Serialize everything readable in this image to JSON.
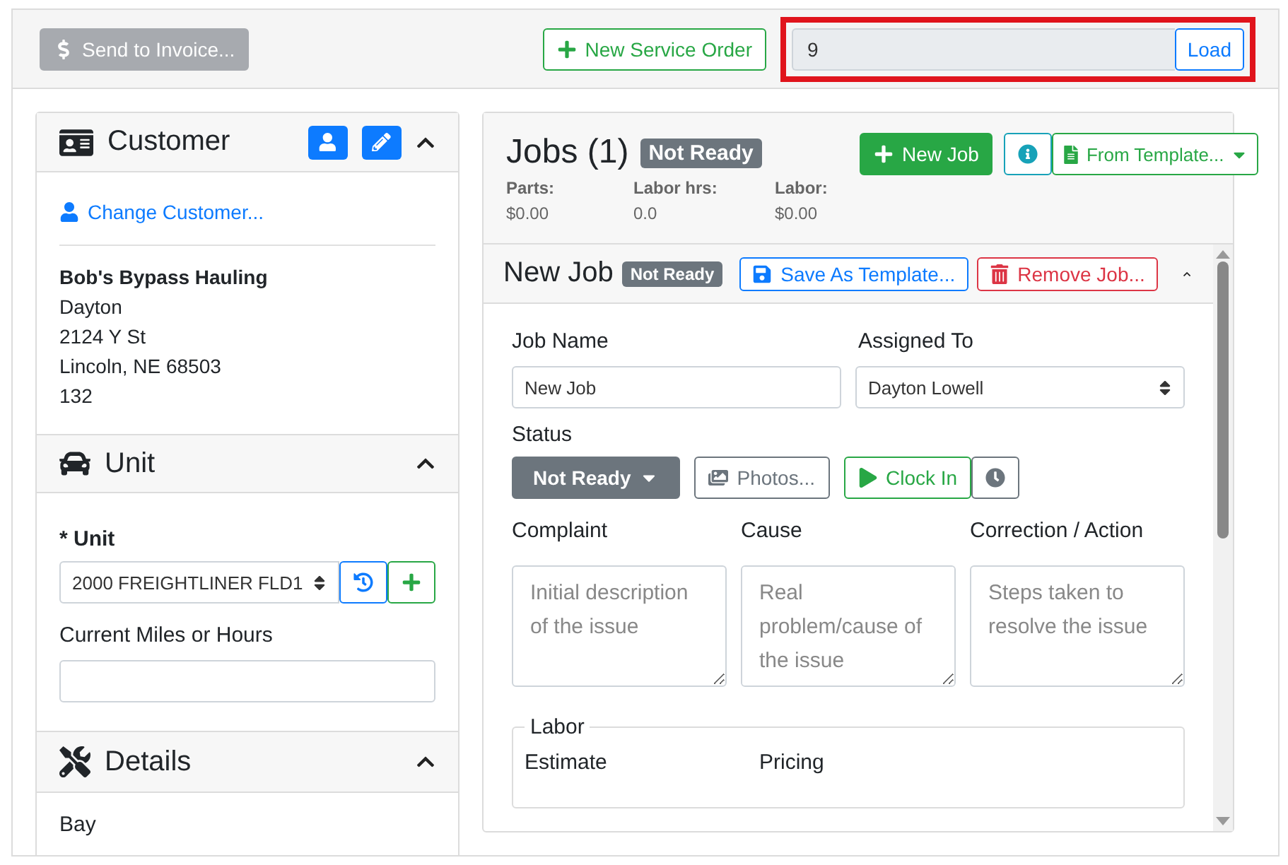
{
  "toolbar": {
    "send_invoice": {
      "label": "Send to Invoice...",
      "disabled": true
    },
    "new_service_order": "New Service Order",
    "order_lookup": {
      "value": "9",
      "button": "Load"
    }
  },
  "customer": {
    "title": "Customer",
    "change_link": "Change Customer...",
    "name": "Bob's Bypass Hauling",
    "lines": [
      "Dayton",
      "2124 Y St",
      "Lincoln, NE 68503",
      "132"
    ]
  },
  "unit": {
    "title": "Unit",
    "unit_label": "* Unit",
    "unit_value": "2000 FREIGHTLINER FLD1",
    "miles_label": "Current Miles or Hours"
  },
  "details": {
    "title": "Details",
    "bay_label": "Bay"
  },
  "jobs": {
    "title": "Jobs (1)",
    "status": "Not Ready",
    "new_job": "New Job",
    "from_template": "From Template...",
    "totals": [
      {
        "label": "Parts:",
        "value": "$0.00"
      },
      {
        "label": "Labor hrs:",
        "value": "0.0"
      },
      {
        "label": "Labor:",
        "value": "$0.00"
      }
    ]
  },
  "job": {
    "name": "New Job",
    "status": "Not Ready",
    "save_template": "Save As Template...",
    "remove": "Remove Job...",
    "job_name_label": "Job Name",
    "job_name_value": "New Job",
    "assigned_label": "Assigned To",
    "assigned_value": "Dayton Lowell",
    "status_label": "Status",
    "status_button": "Not Ready",
    "photos": "Photos...",
    "clock_in": "Clock In",
    "notes": [
      {
        "label": "Complaint",
        "placeholder": "Initial description of the issue"
      },
      {
        "label": "Cause",
        "placeholder": "Real problem/cause of the issue"
      },
      {
        "label": "Correction / Action",
        "placeholder": "Steps taken to resolve the issue"
      }
    ],
    "labor": {
      "title": "Labor",
      "estimate_label": "Estimate",
      "pricing_label": "Pricing"
    }
  }
}
